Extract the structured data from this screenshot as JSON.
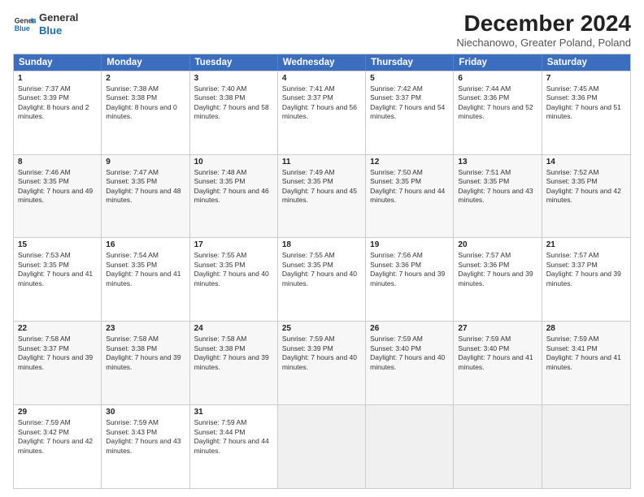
{
  "logo": {
    "line1": "General",
    "line2": "Blue"
  },
  "title": "December 2024",
  "subtitle": "Niechanowo, Greater Poland, Poland",
  "header_days": [
    "Sunday",
    "Monday",
    "Tuesday",
    "Wednesday",
    "Thursday",
    "Friday",
    "Saturday"
  ],
  "weeks": [
    [
      {
        "day": "1",
        "rise": "7:37 AM",
        "set": "3:39 PM",
        "daylight": "8 hours and 2 minutes."
      },
      {
        "day": "2",
        "rise": "7:38 AM",
        "set": "3:38 PM",
        "daylight": "8 hours and 0 minutes."
      },
      {
        "day": "3",
        "rise": "7:40 AM",
        "set": "3:38 PM",
        "daylight": "7 hours and 58 minutes."
      },
      {
        "day": "4",
        "rise": "7:41 AM",
        "set": "3:37 PM",
        "daylight": "7 hours and 56 minutes."
      },
      {
        "day": "5",
        "rise": "7:42 AM",
        "set": "3:37 PM",
        "daylight": "7 hours and 54 minutes."
      },
      {
        "day": "6",
        "rise": "7:44 AM",
        "set": "3:36 PM",
        "daylight": "7 hours and 52 minutes."
      },
      {
        "day": "7",
        "rise": "7:45 AM",
        "set": "3:36 PM",
        "daylight": "7 hours and 51 minutes."
      }
    ],
    [
      {
        "day": "8",
        "rise": "7:46 AM",
        "set": "3:35 PM",
        "daylight": "7 hours and 49 minutes."
      },
      {
        "day": "9",
        "rise": "7:47 AM",
        "set": "3:35 PM",
        "daylight": "7 hours and 48 minutes."
      },
      {
        "day": "10",
        "rise": "7:48 AM",
        "set": "3:35 PM",
        "daylight": "7 hours and 46 minutes."
      },
      {
        "day": "11",
        "rise": "7:49 AM",
        "set": "3:35 PM",
        "daylight": "7 hours and 45 minutes."
      },
      {
        "day": "12",
        "rise": "7:50 AM",
        "set": "3:35 PM",
        "daylight": "7 hours and 44 minutes."
      },
      {
        "day": "13",
        "rise": "7:51 AM",
        "set": "3:35 PM",
        "daylight": "7 hours and 43 minutes."
      },
      {
        "day": "14",
        "rise": "7:52 AM",
        "set": "3:35 PM",
        "daylight": "7 hours and 42 minutes."
      }
    ],
    [
      {
        "day": "15",
        "rise": "7:53 AM",
        "set": "3:35 PM",
        "daylight": "7 hours and 41 minutes."
      },
      {
        "day": "16",
        "rise": "7:54 AM",
        "set": "3:35 PM",
        "daylight": "7 hours and 41 minutes."
      },
      {
        "day": "17",
        "rise": "7:55 AM",
        "set": "3:35 PM",
        "daylight": "7 hours and 40 minutes."
      },
      {
        "day": "18",
        "rise": "7:55 AM",
        "set": "3:35 PM",
        "daylight": "7 hours and 40 minutes."
      },
      {
        "day": "19",
        "rise": "7:56 AM",
        "set": "3:36 PM",
        "daylight": "7 hours and 39 minutes."
      },
      {
        "day": "20",
        "rise": "7:57 AM",
        "set": "3:36 PM",
        "daylight": "7 hours and 39 minutes."
      },
      {
        "day": "21",
        "rise": "7:57 AM",
        "set": "3:37 PM",
        "daylight": "7 hours and 39 minutes."
      }
    ],
    [
      {
        "day": "22",
        "rise": "7:58 AM",
        "set": "3:37 PM",
        "daylight": "7 hours and 39 minutes."
      },
      {
        "day": "23",
        "rise": "7:58 AM",
        "set": "3:38 PM",
        "daylight": "7 hours and 39 minutes."
      },
      {
        "day": "24",
        "rise": "7:58 AM",
        "set": "3:38 PM",
        "daylight": "7 hours and 39 minutes."
      },
      {
        "day": "25",
        "rise": "7:59 AM",
        "set": "3:39 PM",
        "daylight": "7 hours and 40 minutes."
      },
      {
        "day": "26",
        "rise": "7:59 AM",
        "set": "3:40 PM",
        "daylight": "7 hours and 40 minutes."
      },
      {
        "day": "27",
        "rise": "7:59 AM",
        "set": "3:40 PM",
        "daylight": "7 hours and 41 minutes."
      },
      {
        "day": "28",
        "rise": "7:59 AM",
        "set": "3:41 PM",
        "daylight": "7 hours and 41 minutes."
      }
    ],
    [
      {
        "day": "29",
        "rise": "7:59 AM",
        "set": "3:42 PM",
        "daylight": "7 hours and 42 minutes."
      },
      {
        "day": "30",
        "rise": "7:59 AM",
        "set": "3:43 PM",
        "daylight": "7 hours and 43 minutes."
      },
      {
        "day": "31",
        "rise": "7:59 AM",
        "set": "3:44 PM",
        "daylight": "7 hours and 44 minutes."
      },
      null,
      null,
      null,
      null
    ]
  ],
  "labels": {
    "sunrise": "Sunrise: ",
    "sunset": "Sunset: ",
    "daylight": "Daylight: "
  }
}
